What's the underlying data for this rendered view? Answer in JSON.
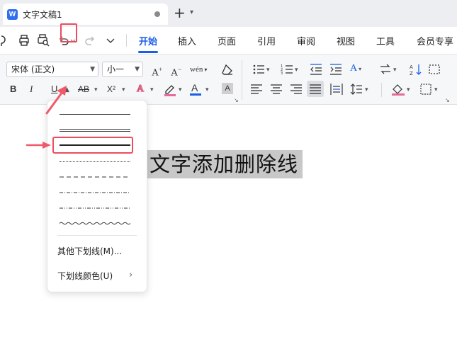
{
  "window": {
    "tab_title": "文字文稿1",
    "app_logo_letter": "W",
    "new_tab_glyph": "+",
    "tab_menu_glyph": "▾"
  },
  "menu": {
    "items": [
      "开始",
      "插入",
      "页面",
      "引用",
      "审阅",
      "视图",
      "工具",
      "会员专享"
    ],
    "active": "开始"
  },
  "ribbon": {
    "font_name": "宋体 (正文)",
    "font_size": "小一",
    "bold": "B",
    "italic": "I",
    "underline": "U",
    "superscript": "X²",
    "font_color_letter": "A",
    "highlight_letter": "A",
    "grow_font": "A",
    "shrink_font": "A",
    "phonetic": "wén",
    "text_effect": "A",
    "char_border": "A",
    "strike_letter": "AB"
  },
  "document": {
    "selected_text": "文字添加删除线"
  },
  "underline_menu": {
    "styles": [
      "single",
      "double",
      "thick",
      "dotted",
      "dashed",
      "dash-dot",
      "dash-dot-dot",
      "wave"
    ],
    "selected": "thick",
    "more_label": "其他下划线(M)...",
    "color_label": "下划线颜色(U)",
    "submenu_arrow": "›"
  },
  "colors": {
    "accent": "#1a5ee8",
    "annotation": "#ec4d5e",
    "selection": "#c8c8c8",
    "font_color_bar": "#1a5ee8",
    "highlight_bar": "#e66b9c"
  },
  "annotations": {
    "arrow_glyph": "▲"
  }
}
